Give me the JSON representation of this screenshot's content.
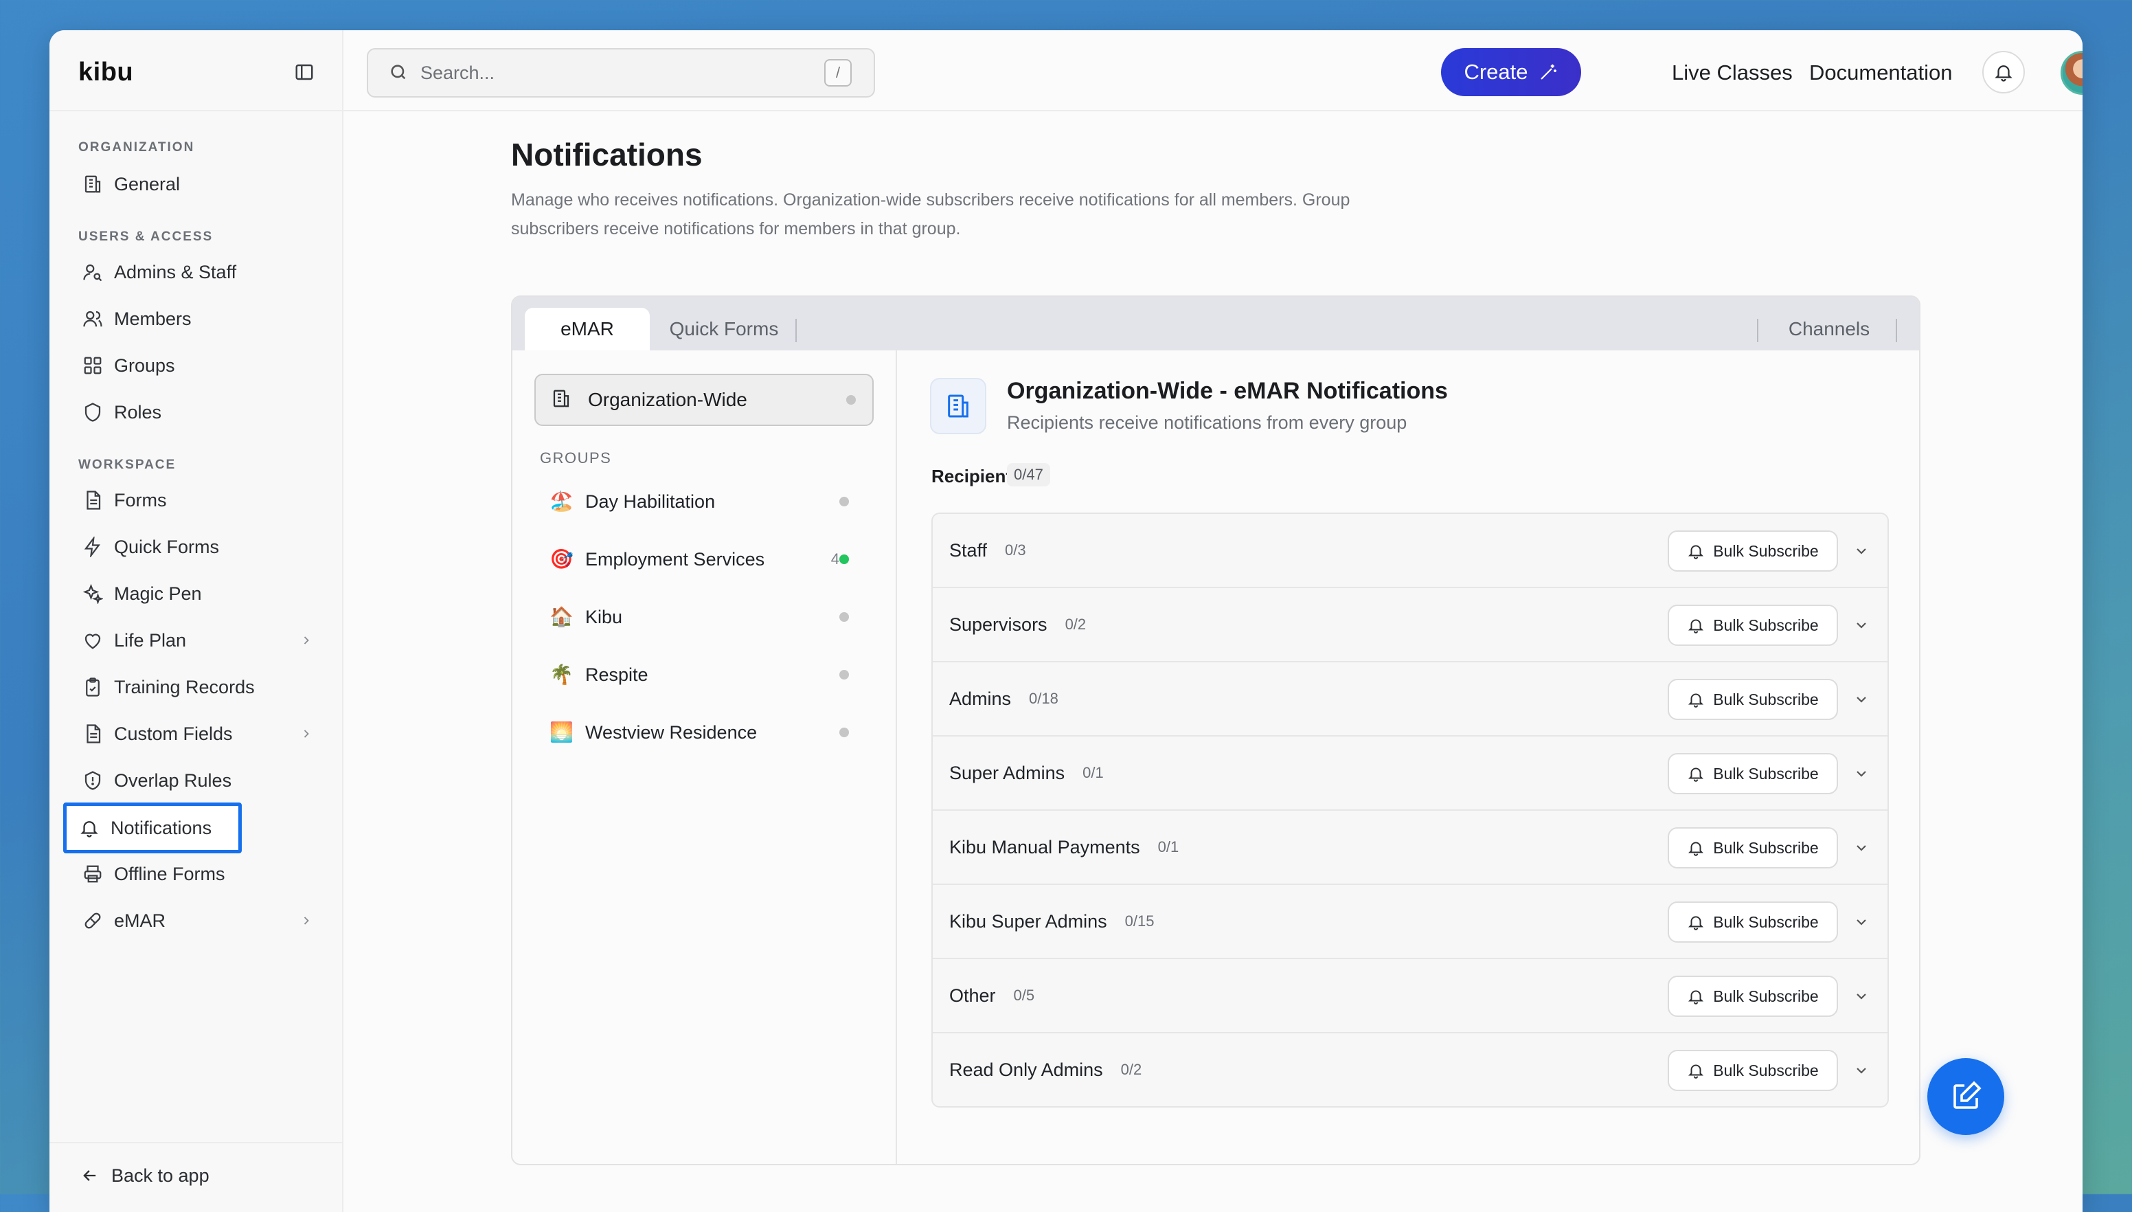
{
  "brand": "kibu",
  "sidebar": {
    "sections": {
      "organization": "ORGANIZATION",
      "users_access": "USERS & ACCESS",
      "workspace": "WORKSPACE"
    },
    "items": {
      "general": "General",
      "admins_staff": "Admins & Staff",
      "members": "Members",
      "groups": "Groups",
      "roles": "Roles",
      "forms": "Forms",
      "quick_forms": "Quick Forms",
      "magic_pen": "Magic Pen",
      "life_plan": "Life Plan",
      "training_records": "Training Records",
      "custom_fields": "Custom Fields",
      "overlap_rules": "Overlap Rules",
      "notifications": "Notifications",
      "offline_forms": "Offline Forms",
      "emar": "eMAR"
    },
    "back": "Back to app"
  },
  "header": {
    "search_placeholder": "Search...",
    "search_shortcut": "/",
    "create": "Create",
    "live_classes": "Live Classes",
    "documentation": "Documentation"
  },
  "page": {
    "title": "Notifications",
    "description": "Manage who receives notifications. Organization-wide subscribers receive notifications for all members. Group subscribers receive notifications for members in that group."
  },
  "tabs": {
    "emar": "eMAR",
    "quick_forms": "Quick Forms",
    "channels": "Channels"
  },
  "left": {
    "org_wide": "Organization-Wide",
    "groups_label": "GROUPS",
    "groups": [
      {
        "emoji": "🏖️",
        "name": "Day Habilitation",
        "count": ""
      },
      {
        "emoji": "🎯",
        "name": "Employment Services",
        "count": "4"
      },
      {
        "emoji": "🏠",
        "name": "Kibu",
        "count": ""
      },
      {
        "emoji": "🌴",
        "name": "Respite",
        "count": ""
      },
      {
        "emoji": "🌅",
        "name": "Westview Residence",
        "count": ""
      }
    ]
  },
  "right": {
    "title": "Organization-Wide - eMAR Notifications",
    "subtitle": "Recipients receive notifications from every group",
    "recipients_label": "Recipients",
    "recipients_count": "0/47",
    "bulk_label": "Bulk Subscribe",
    "rows": [
      {
        "name": "Staff",
        "count": "0/3"
      },
      {
        "name": "Supervisors",
        "count": "0/2"
      },
      {
        "name": "Admins",
        "count": "0/18"
      },
      {
        "name": "Super Admins",
        "count": "0/1"
      },
      {
        "name": "Kibu Manual Payments",
        "count": "0/1"
      },
      {
        "name": "Kibu Super Admins",
        "count": "0/15"
      },
      {
        "name": "Other",
        "count": "0/5"
      },
      {
        "name": "Read Only Admins",
        "count": "0/2"
      }
    ]
  },
  "colors": {
    "accent": "#1670ee",
    "create_button": "#2f36d2",
    "active_dot": "#22c55e"
  }
}
